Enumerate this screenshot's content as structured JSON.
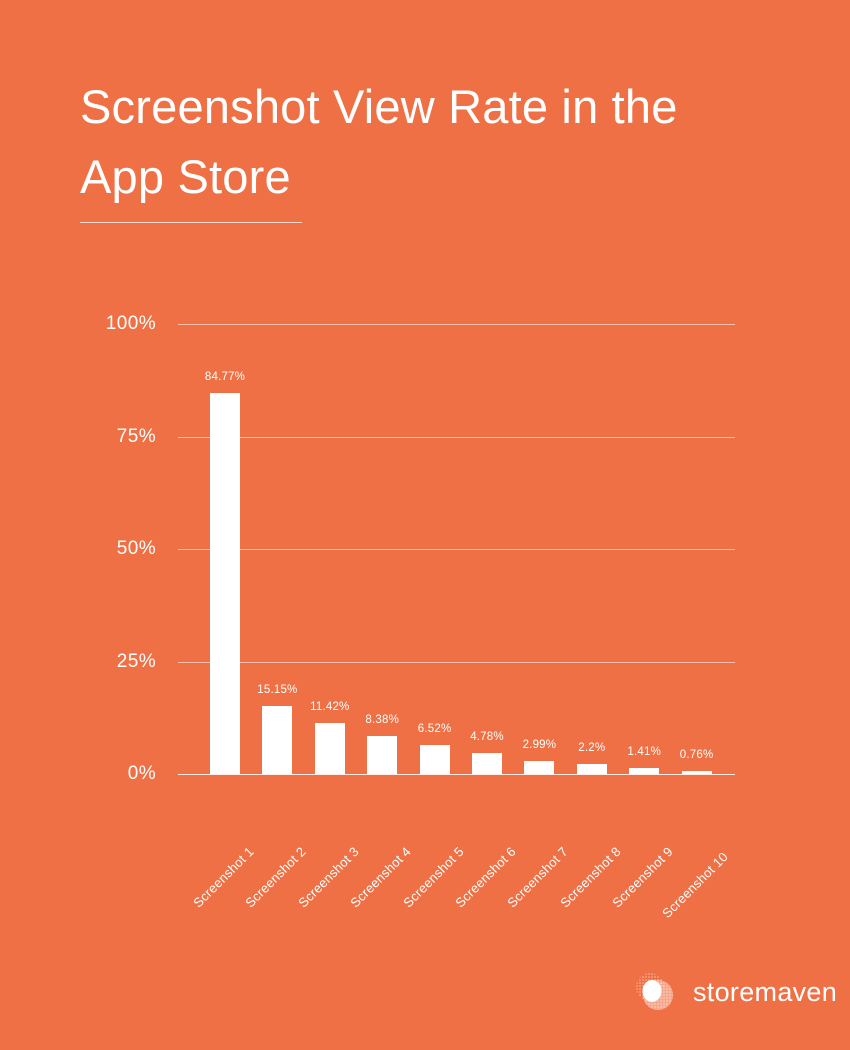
{
  "title": {
    "line1": "Screenshot View Rate in the",
    "line2": "App Store"
  },
  "colors": {
    "background": "#ef7044",
    "bar": "#ffffff",
    "text": "#ffffff",
    "gridline": "rgba(255,255,255,0.55)"
  },
  "logo": {
    "wordmark": "storemaven",
    "mark_icon": "storemaven-circles-icon"
  },
  "chart_data": {
    "type": "bar",
    "title": "Screenshot View Rate in the App Store",
    "xlabel": "",
    "ylabel": "",
    "categories": [
      "Screenshot 1",
      "Screenshot 2",
      "Screenshot 3",
      "Screenshot 4",
      "Screenshot 5",
      "Screenshot 6",
      "Screenshot 7",
      "Screenshot 8",
      "Screenshot 9",
      "Screenshot 10"
    ],
    "values": [
      84.77,
      15.15,
      11.42,
      8.38,
      6.52,
      4.78,
      2.99,
      2.2,
      1.41,
      0.76
    ],
    "data_labels": [
      "84.77%",
      "15.15%",
      "11.42%",
      "8.38%",
      "6.52%",
      "4.78%",
      "2.99%",
      "2.2%",
      "1.41%",
      "0.76%"
    ],
    "ylim": [
      0,
      100
    ],
    "yticks": [
      0,
      25,
      50,
      75,
      100
    ],
    "ytick_labels": [
      "0%",
      "25%",
      "50%",
      "75%",
      "100%"
    ],
    "grid": true,
    "legend": false,
    "legend_position": "none",
    "xtick_rotation": -45
  }
}
